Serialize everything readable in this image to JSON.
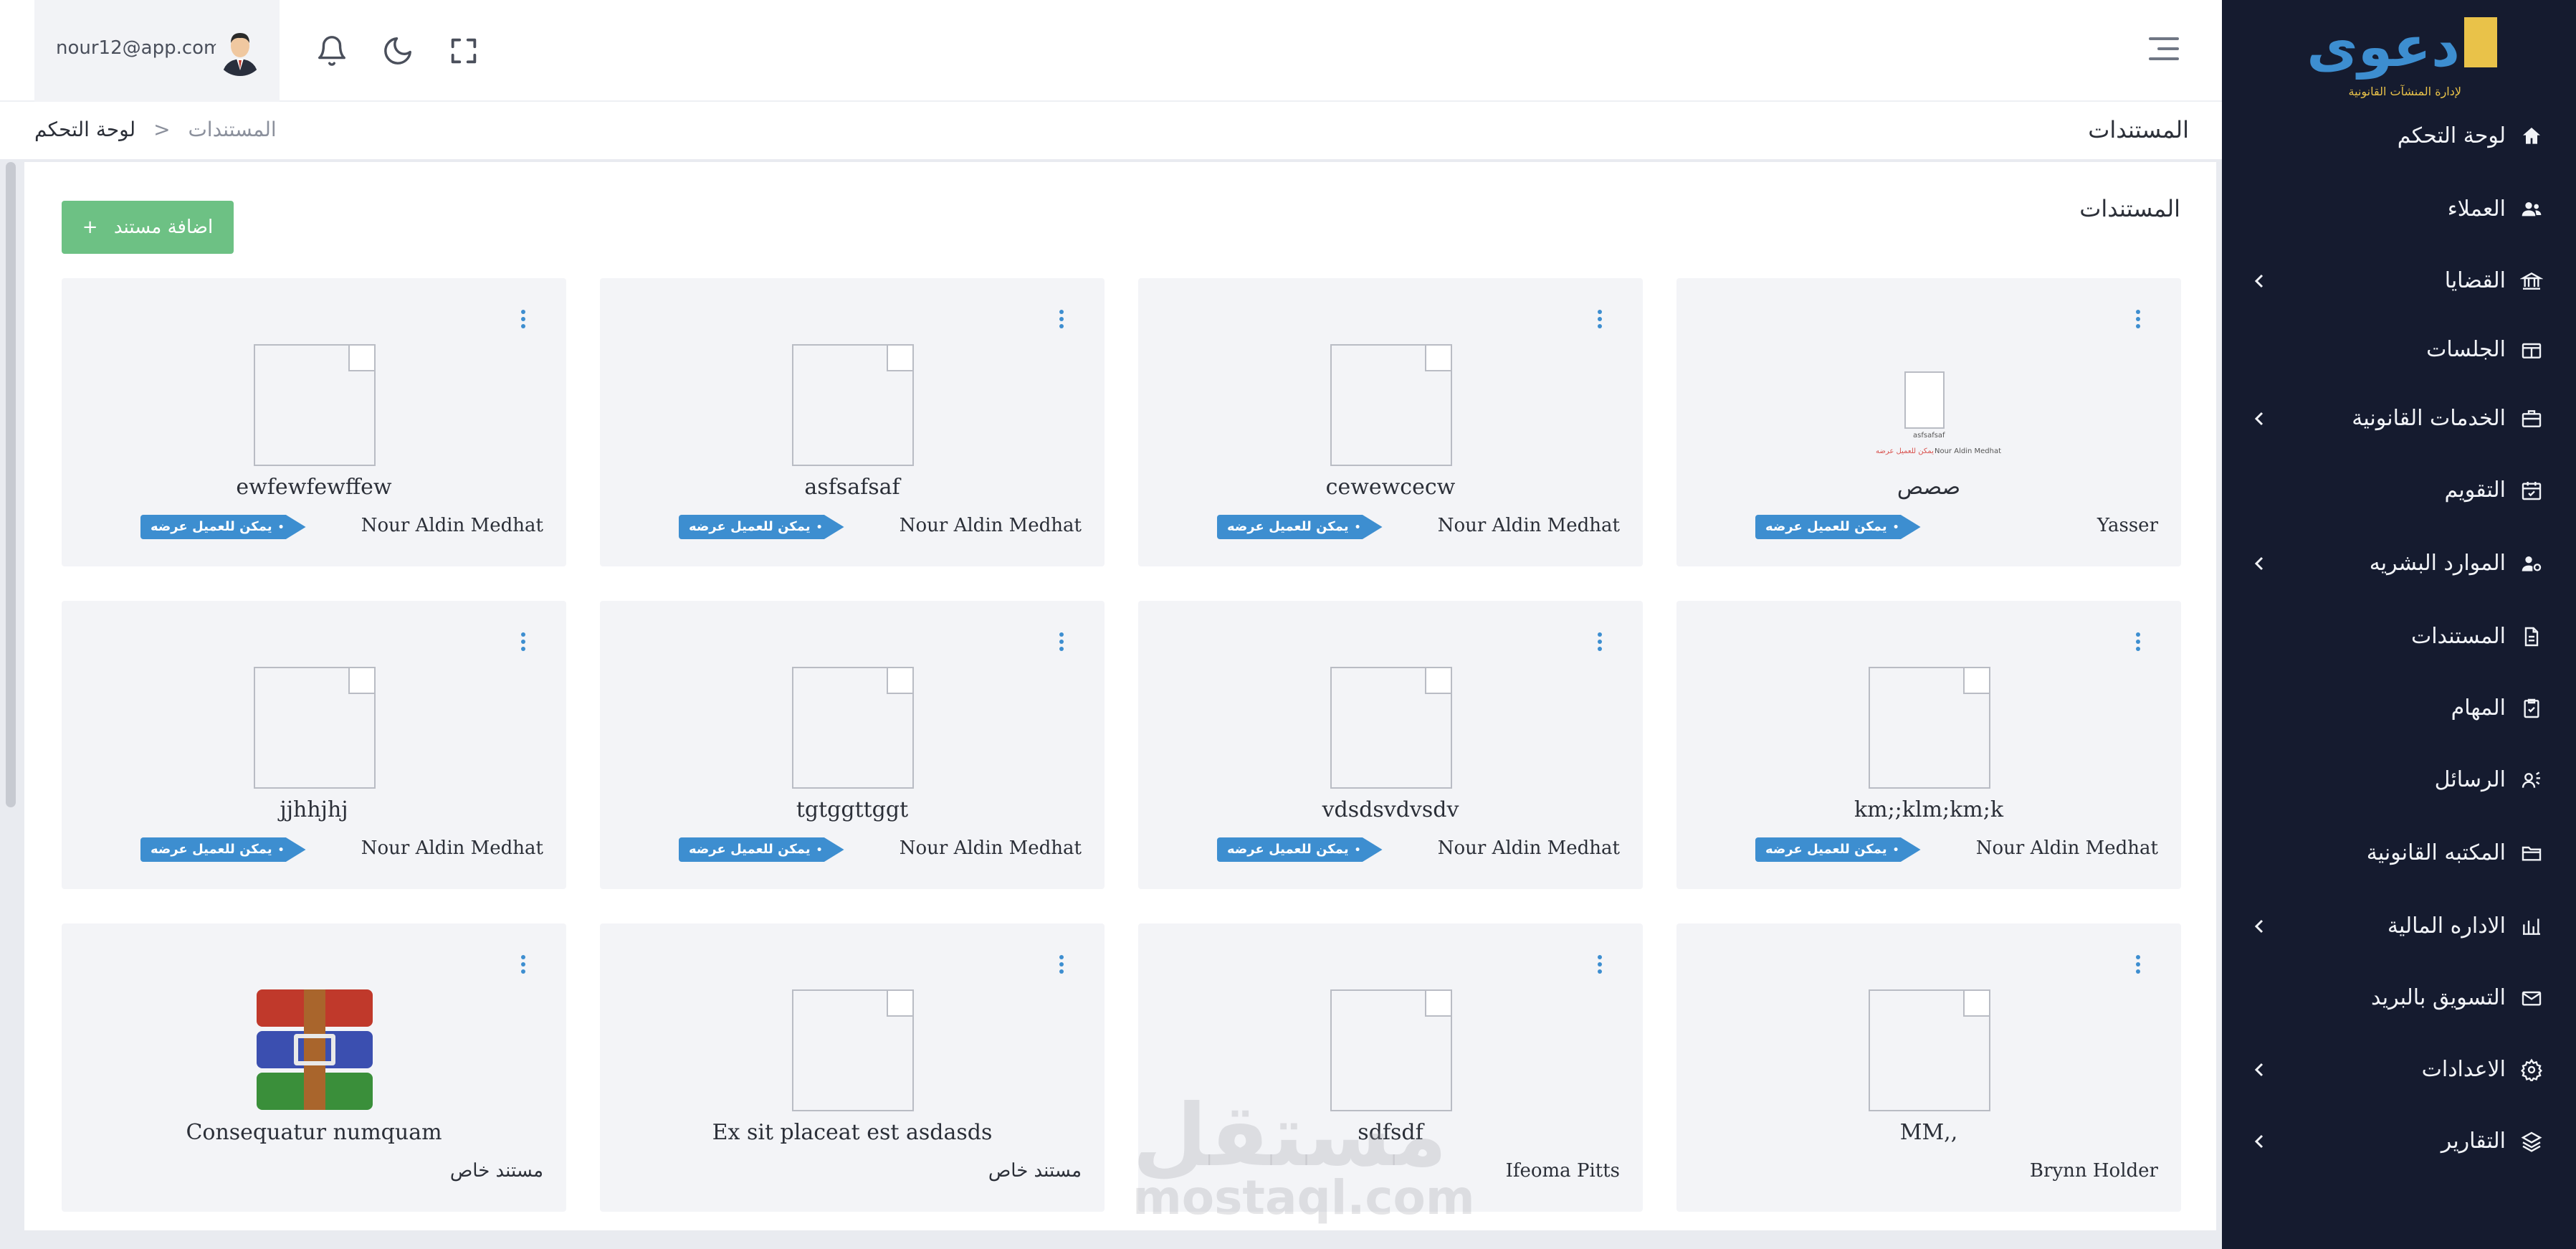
{
  "sidebar": {
    "logo_text": "دعوى",
    "logo_subtitle": "لإدارة المنشآت القانونية",
    "items": [
      {
        "label": "لوحة التحكم",
        "icon": "home-icon",
        "has_children": false
      },
      {
        "label": "العملاء",
        "icon": "users-icon",
        "has_children": false
      },
      {
        "label": "القضايا",
        "icon": "court-icon",
        "has_children": true
      },
      {
        "label": "الجلسات",
        "icon": "session-icon",
        "has_children": false
      },
      {
        "label": "الخدمات القانونية",
        "icon": "briefcase-icon",
        "has_children": true
      },
      {
        "label": "التقويم",
        "icon": "calendar-icon",
        "has_children": false
      },
      {
        "label": "الموارد البشريه",
        "icon": "user-gear-icon",
        "has_children": true
      },
      {
        "label": "المستندات",
        "icon": "document-icon",
        "has_children": false
      },
      {
        "label": "المهام",
        "icon": "tasks-icon",
        "has_children": false
      },
      {
        "label": "الرسائل",
        "icon": "messages-icon",
        "has_children": false
      },
      {
        "label": "المكتبه القانونية",
        "icon": "folder-icon",
        "has_children": false
      },
      {
        "label": "الاداره المالية",
        "icon": "finance-icon",
        "has_children": true
      },
      {
        "label": "التسويق بالبريد",
        "icon": "mail-icon",
        "has_children": false
      },
      {
        "label": "الاعدادات",
        "icon": "settings-icon",
        "has_children": true
      },
      {
        "label": "التقارير",
        "icon": "layers-icon",
        "has_children": true
      }
    ]
  },
  "header": {
    "user_email": "nour12@app.com",
    "icons": [
      "bell-icon",
      "moon-icon",
      "fullscreen-icon",
      "menu-icon"
    ]
  },
  "breadcrumb": {
    "page_title": "المستندات",
    "home": "لوحة التحكم",
    "separator": "<",
    "current": "المستندات"
  },
  "panel": {
    "title": "المستندات",
    "add_button": "اضافة مستند",
    "add_button_icon": "+"
  },
  "badge_label": "يمكن للعميل عرضه",
  "cards": [
    {
      "name": "ewfewfewffew",
      "owner": "Nour Aldin Medhat",
      "badge": true,
      "thumb": "broken"
    },
    {
      "name": "asfsafsaf",
      "owner": "Nour Aldin Medhat",
      "badge": true,
      "thumb": "broken"
    },
    {
      "name": "cewewcecw",
      "owner": "Nour Aldin Medhat",
      "badge": true,
      "thumb": "broken"
    },
    {
      "name": "صصص",
      "owner": "Yasser",
      "badge": true,
      "thumb": "document-preview"
    },
    {
      "name": "jjhhjhj",
      "owner": "Nour Aldin Medhat",
      "badge": true,
      "thumb": "broken"
    },
    {
      "name": "tgtggttggt",
      "owner": "Nour Aldin Medhat",
      "badge": true,
      "thumb": "broken"
    },
    {
      "name": "vdsdsvdvsdv",
      "owner": "Nour Aldin Medhat",
      "badge": true,
      "thumb": "broken"
    },
    {
      "name": "km;;klm;km;k",
      "owner": "Nour Aldin Medhat",
      "badge": true,
      "thumb": "broken"
    },
    {
      "name": "Consequatur numquam",
      "owner": "مستند خاص",
      "badge": false,
      "thumb": "archive-icon"
    },
    {
      "name": "Ex sit placeat est asdasds",
      "owner": "مستند خاص",
      "badge": false,
      "thumb": "broken"
    },
    {
      "name": "sdfsdf",
      "owner": "Ifeoma Pitts",
      "badge": false,
      "thumb": "broken"
    },
    {
      "name": "MM,,",
      "owner": "Brynn Holder",
      "badge": false,
      "thumb": "broken"
    }
  ],
  "preview_doc": {
    "name": "asfsafsaf",
    "owner": "Nour Aldin Medhat",
    "badge": "يمكن للعميل عرضه"
  },
  "watermark": {
    "text": "مستقل",
    "sub": "mostaql.com"
  },
  "colors": {
    "sidebar_bg": "#151b2f",
    "accent_blue": "#3d8ed0",
    "add_green": "#6dc184",
    "card_bg": "#f3f4f7",
    "logo_yellow": "#e9c249"
  }
}
